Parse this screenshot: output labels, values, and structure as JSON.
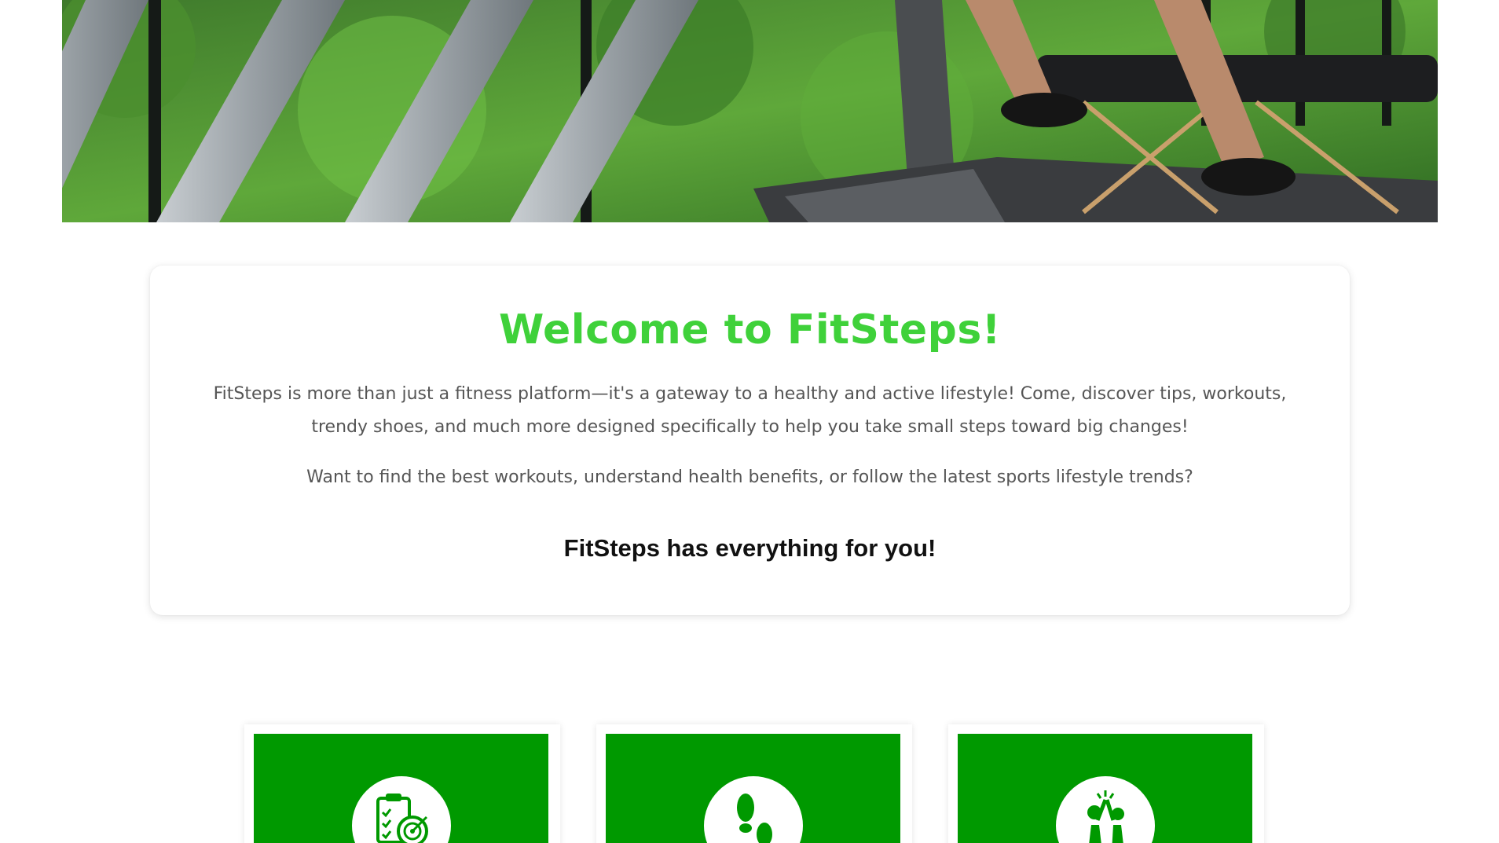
{
  "hero": {
    "image": "gym-treadmill-photo"
  },
  "welcome": {
    "title": "Welcome to FitSteps!",
    "paragraph_1": "FitSteps is more than just a fitness platform—it's a gateway to a healthy and active lifestyle! Come, discover tips, workouts, trendy shoes, and much more designed specifically to help you take small steps toward big changes!",
    "paragraph_2": "Want to find the best workouts, understand health benefits, or follow the latest sports lifestyle trends?",
    "tagline": "FitSteps has everything for you!"
  },
  "features": [
    {
      "icon": "clipboard-target-icon"
    },
    {
      "icon": "footprints-icon"
    },
    {
      "icon": "high-five-icon"
    }
  ],
  "colors": {
    "accent_green": "#3fd13a",
    "panel_green": "#009900",
    "body_text": "#555555"
  }
}
